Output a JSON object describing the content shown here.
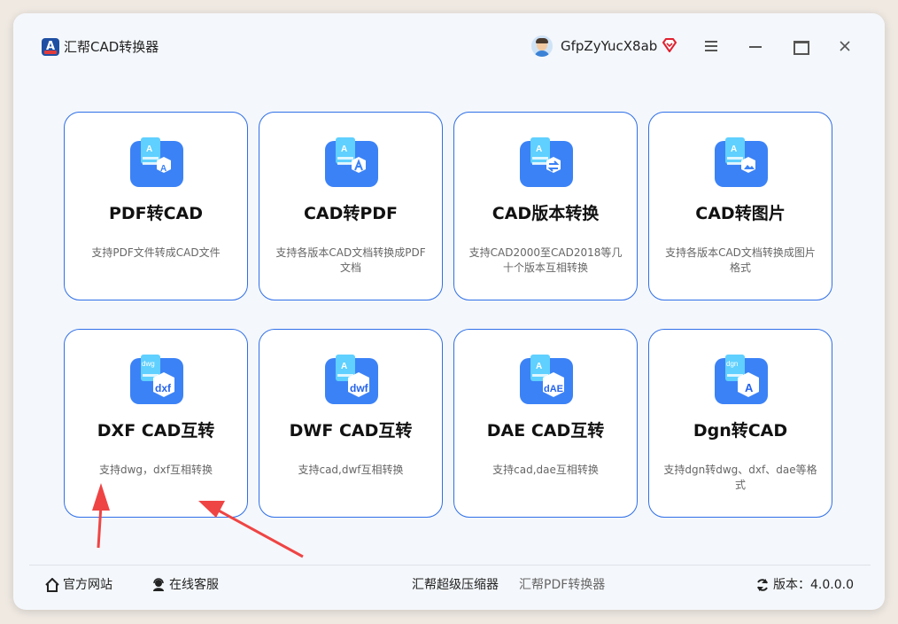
{
  "app": {
    "title": "汇帮CAD转换器",
    "username": "GfpZyYucX8ab"
  },
  "cards": [
    {
      "title": "PDF转CAD",
      "desc": "支持PDF文件转成CAD文件",
      "icon": "pdf-to-cad-icon"
    },
    {
      "title": "CAD转PDF",
      "desc": "支持各版本CAD文档转换成PDF文档",
      "icon": "cad-to-pdf-icon"
    },
    {
      "title": "CAD版本转换",
      "desc": "支持CAD2000至CAD2018等几十个版本互相转换",
      "icon": "cad-version-convert-icon"
    },
    {
      "title": "CAD转图片",
      "desc": "支持各版本CAD文档转换成图片格式",
      "icon": "cad-to-image-icon"
    },
    {
      "title": "DXF CAD互转",
      "desc": "支持dwg，dxf互相转换",
      "icon": "dxf-icon",
      "badge": "dxf",
      "tag": "dwg"
    },
    {
      "title": "DWF CAD互转",
      "desc": "支持cad,dwf互相转换",
      "icon": "dwf-icon",
      "badge": "dwf"
    },
    {
      "title": "DAE CAD互转",
      "desc": "支持cad,dae互相转换",
      "icon": "dae-icon",
      "badge": "dAE"
    },
    {
      "title": "Dgn转CAD",
      "desc": "支持dgn转dwg、dxf、dae等格式",
      "icon": "dgn-icon",
      "badge": "A",
      "tag": "dgn"
    }
  ],
  "footer": {
    "website": "官方网站",
    "support": "在线客服",
    "link1": "汇帮超级压缩器",
    "link2": "汇帮PDF转换器",
    "version": "版本：4.0.0.0"
  },
  "colors": {
    "accent": "#2f6fe8",
    "icon_blue": "#3b82f6",
    "arrow": "#ef4444"
  }
}
